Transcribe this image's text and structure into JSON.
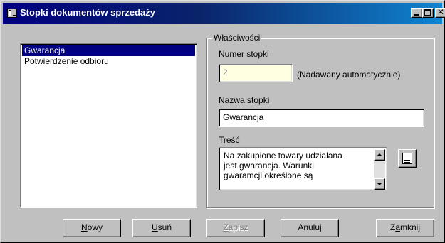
{
  "window": {
    "title": "Stopki dokumentów sprzedaży",
    "title_icon": "list-window-icon",
    "controls": {
      "minimize_icon": "minimize-icon",
      "maximize_icon": "maximize-icon",
      "close_icon": "close-icon",
      "close_glyph": "✕"
    }
  },
  "footers_list": {
    "items": [
      {
        "label": "Gwarancja",
        "selected": true
      },
      {
        "label": "Potwierdzenie odbioru",
        "selected": false
      }
    ]
  },
  "properties": {
    "group_label": "Właściwości",
    "number_label": "Numer stopki",
    "number_value": "2",
    "number_hint": "(Nadawany automatycznie)",
    "name_label": "Nazwa stopki",
    "name_value": "Gwarancja",
    "content_label": "Treść",
    "content_lines": [
      "Na zakupione towary udzialana",
      "jest gwarancja. Warunki",
      "gwaramcji określone są"
    ],
    "editor_icon": "notepad-icon"
  },
  "buttons": {
    "new": {
      "mnemonic": "N",
      "rest": "owy",
      "enabled": true
    },
    "delete": {
      "mnemonic": "U",
      "rest": "suń",
      "enabled": true
    },
    "save": {
      "mnemonic": "Z",
      "rest": "apisz",
      "enabled": false
    },
    "cancel": {
      "label": "Anuluj",
      "enabled": true
    },
    "close": {
      "pre": "Z",
      "mnemonic": "a",
      "rest": "mknij",
      "enabled": true
    }
  },
  "colors": {
    "title_gradient_start": "#000080",
    "title_gradient_end": "#1084d0",
    "face": "#c0c0c0",
    "selection": "#000080",
    "disabled_field_bg": "#ffffe1"
  }
}
